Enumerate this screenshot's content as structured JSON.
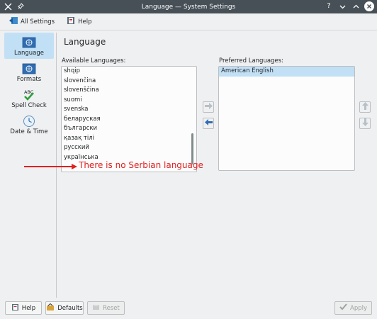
{
  "window": {
    "title": "Language — System Settings"
  },
  "toolbar": {
    "all_settings_label": "All Settings",
    "help_label": "Help"
  },
  "sidebar": {
    "items": [
      {
        "label": "Language",
        "icon": "language-flag-icon",
        "active": true
      },
      {
        "label": "Formats",
        "icon": "formats-flag-icon",
        "active": false
      },
      {
        "label": "Spell Check",
        "icon": "spell-check-icon",
        "active": false
      },
      {
        "label": "Date & Time",
        "icon": "clock-icon",
        "active": false
      }
    ]
  },
  "main": {
    "title": "Language",
    "available_label": "Available Languages:",
    "preferred_label": "Preferred Languages:",
    "available_languages": [
      "shqip",
      "slovenčina",
      "slovenščina",
      "suomi",
      "svenska",
      "беларуская",
      "български",
      "қазақ тілі",
      "русский",
      "українська"
    ],
    "preferred_languages": [
      "American English"
    ]
  },
  "annotation": {
    "text": "There is no Serbian language",
    "color": "#e02020"
  },
  "footer": {
    "help_label": "Help",
    "defaults_label": "Defaults",
    "reset_label": "Reset",
    "apply_label": "Apply"
  },
  "colors": {
    "titlebar": "#475057",
    "selection": "#c2e0f5",
    "window_bg": "#eff0f1"
  }
}
